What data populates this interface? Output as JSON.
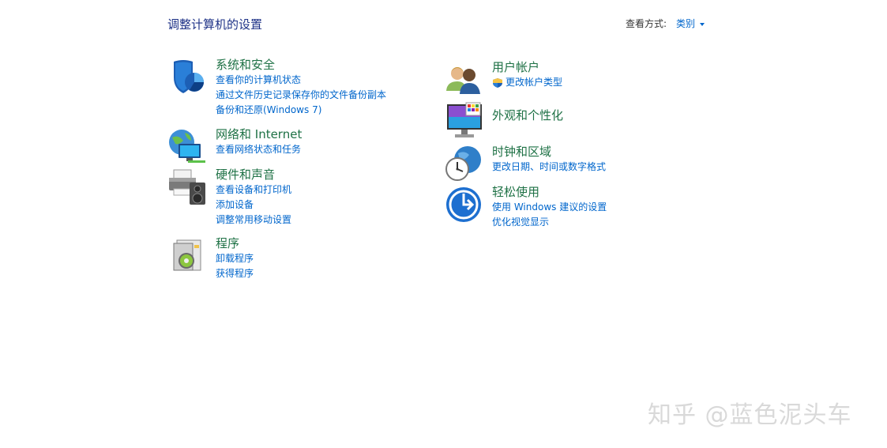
{
  "header": {
    "title": "调整计算机的设置",
    "view_by_label": "查看方式:",
    "view_by_value": "类别"
  },
  "left_column": [
    {
      "title": "系统和安全",
      "icon": "shield-icon",
      "links": [
        "查看你的计算机状态",
        "通过文件历史记录保存你的文件备份副本",
        "备份和还原(Windows 7)"
      ]
    },
    {
      "title": "网络和 Internet",
      "icon": "network-globe-icon",
      "links": [
        "查看网络状态和任务"
      ]
    },
    {
      "title": "硬件和声音",
      "icon": "printer-speaker-icon",
      "links": [
        "查看设备和打印机",
        "添加设备",
        "调整常用移动设置"
      ]
    },
    {
      "title": "程序",
      "icon": "programs-disc-icon",
      "links": [
        "卸载程序",
        "获得程序"
      ]
    }
  ],
  "right_column": [
    {
      "title": "用户帐户",
      "icon": "users-icon",
      "links": [
        "更改帐户类型"
      ]
    },
    {
      "title": "外观和个性化",
      "icon": "monitor-palette-icon",
      "links": []
    },
    {
      "title": "时钟和区域",
      "icon": "clock-globe-icon",
      "links": [
        "更改日期、时间或数字格式"
      ]
    },
    {
      "title": "轻松使用",
      "icon": "ease-of-access-icon",
      "links": [
        "使用 Windows 建议的设置",
        "优化视觉显示"
      ]
    }
  ],
  "watermark": "知乎 @蓝色泥头车",
  "colors": {
    "title_blue": "#1e3287",
    "category_green": "#1e7145",
    "link_blue": "#0066cc"
  }
}
